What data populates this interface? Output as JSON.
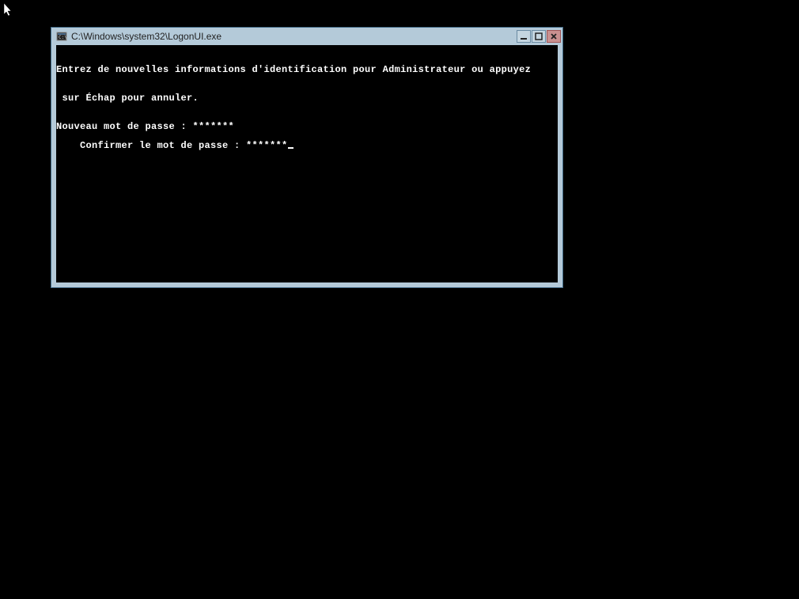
{
  "window": {
    "title": "C:\\Windows\\system32\\LogonUI.exe"
  },
  "console": {
    "line1": "Entrez de nouvelles informations d'identification pour Administrateur ou appuyez",
    "line2": " sur Échap pour annuler.",
    "line3": "Nouveau mot de passe : *******",
    "line4": "Confirmer le mot de passe : *******"
  },
  "icons": {
    "app": "console-icon",
    "minimize": "minimize-icon",
    "maximize": "maximize-icon",
    "close": "close-icon"
  }
}
